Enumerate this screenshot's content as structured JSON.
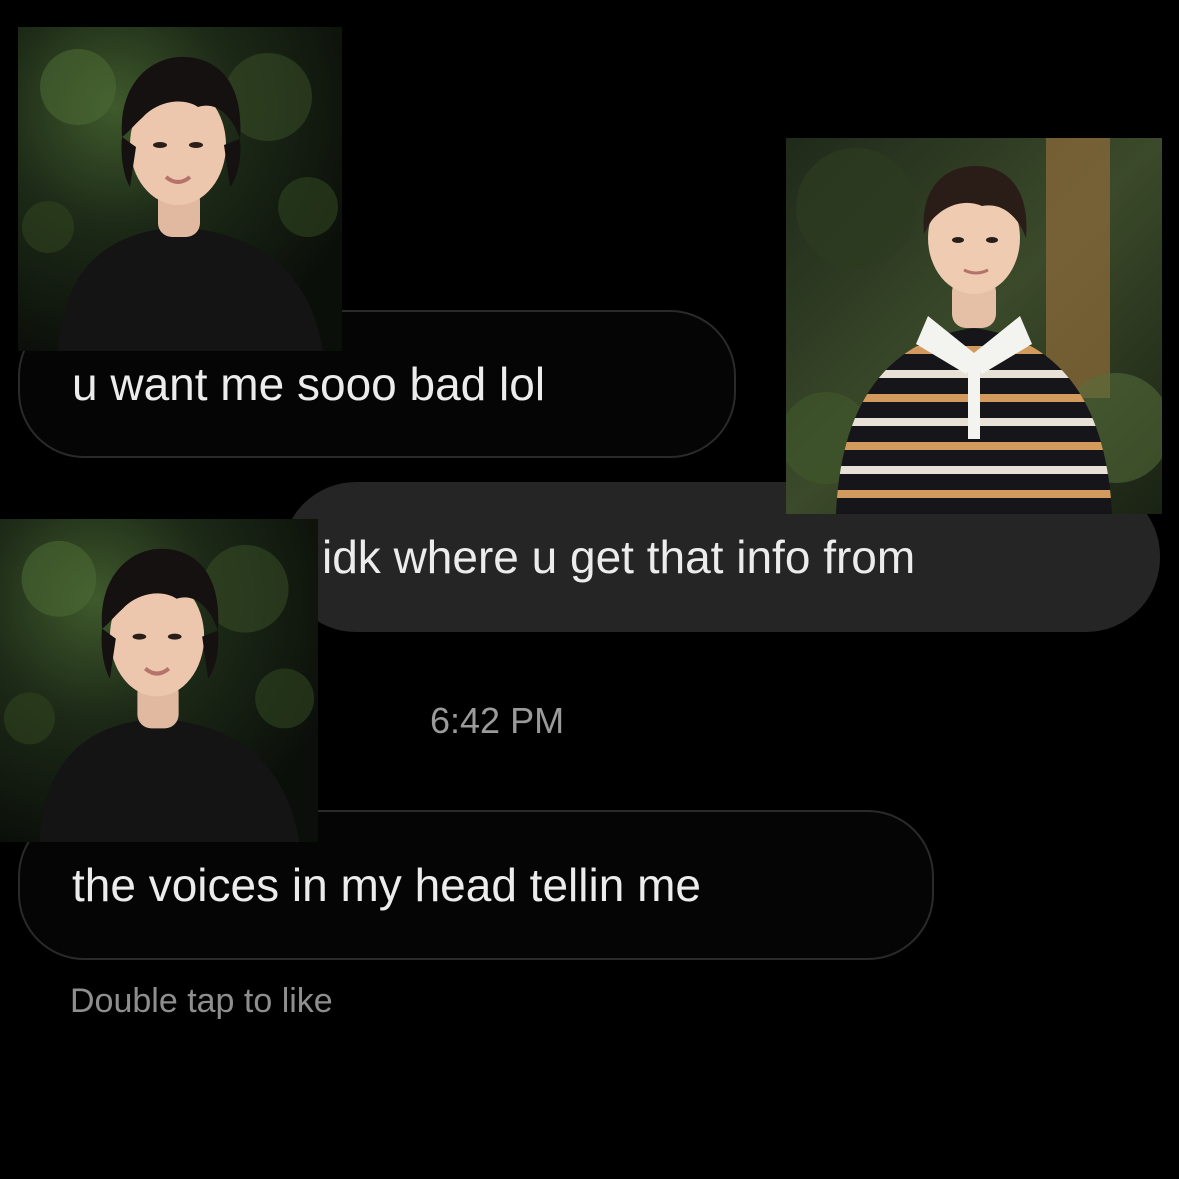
{
  "messages": [
    {
      "sender": "them",
      "text": "u want me sooo bad lol"
    },
    {
      "sender": "me",
      "text": "idk where u get that info from"
    },
    {
      "sender": "them",
      "text": "the voices in my head tellin me"
    }
  ],
  "timestamp": "6:42 PM",
  "double_tap_hint": "Double tap to like",
  "colors": {
    "background": "#000000",
    "received_bubble_border": "#2a2a2a",
    "sent_bubble": "#252525",
    "message_text": "#ececec",
    "meta_text": "#9a9a9a"
  },
  "photos": [
    {
      "name": "person-photo-dark-shirt"
    },
    {
      "name": "person-photo-striped-shirt"
    },
    {
      "name": "person-photo-dark-shirt"
    }
  ]
}
